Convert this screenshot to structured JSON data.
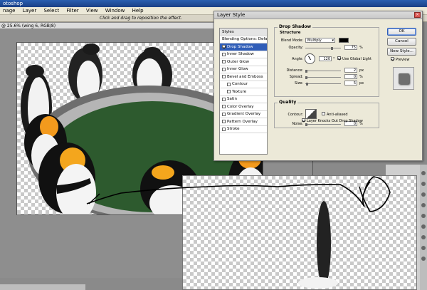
{
  "app": {
    "title_fragment": "otoshop"
  },
  "menu": [
    "nage",
    "Layer",
    "Select",
    "Filter",
    "View",
    "Window",
    "Help"
  ],
  "options_bar": {
    "hint": "Click and drag to reposition the effect."
  },
  "document": {
    "tab_fragment": "@ 25.6% (wing 6, RGB/8)"
  },
  "dialog": {
    "title": "Layer Style",
    "close_glyph": "×",
    "styles_header": "Styles",
    "blending_options": "Blending Options: Default",
    "style_items": [
      {
        "label": "Drop Shadow",
        "checked": true,
        "selected": true
      },
      {
        "label": "Inner Shadow",
        "checked": false
      },
      {
        "label": "Outer Glow",
        "checked": false
      },
      {
        "label": "Inner Glow",
        "checked": false
      },
      {
        "label": "Bevel and Emboss",
        "checked": false
      },
      {
        "label": "Contour",
        "checked": false,
        "indent": true
      },
      {
        "label": "Texture",
        "checked": false,
        "indent": true
      },
      {
        "label": "Satin",
        "checked": false
      },
      {
        "label": "Color Overlay",
        "checked": false
      },
      {
        "label": "Gradient Overlay",
        "checked": false
      },
      {
        "label": "Pattern Overlay",
        "checked": false
      },
      {
        "label": "Stroke",
        "checked": false
      }
    ],
    "drop_shadow": {
      "section_title": "Drop Shadow",
      "structure_title": "Structure",
      "blend_mode_label": "Blend Mode:",
      "blend_mode_value": "Multiply",
      "shadow_color": "#000000",
      "opacity_label": "Opacity:",
      "opacity_value": "75",
      "opacity_fraction": 0.75,
      "opacity_unit": "%",
      "angle_label": "Angle:",
      "angle_value": "120",
      "angle_unit": "°",
      "global_light_label": "Use Global Light",
      "distance_label": "Distance:",
      "distance_value": "2",
      "distance_unit": "px",
      "spread_label": "Spread:",
      "spread_value": "0",
      "spread_unit": "%",
      "size_label": "Size:",
      "size_value": "5",
      "size_unit": "px",
      "quality_title": "Quality",
      "contour_label": "Contour:",
      "anti_aliased_label": "Anti-aliased",
      "noise_label": "Noise:",
      "noise_value": "0",
      "noise_unit": "%",
      "knockout_label": "Layer Knocks Out Drop Shadow"
    },
    "buttons": {
      "ok": "OK",
      "cancel": "Cancel",
      "new_style": "New Style...",
      "preview_label": "Preview"
    }
  },
  "status": {
    "zoom_fragment": ""
  },
  "colors": {
    "accent": "#2f5db8",
    "table_green": "#2d5a2e",
    "table_rim": "#b5b5b5"
  }
}
